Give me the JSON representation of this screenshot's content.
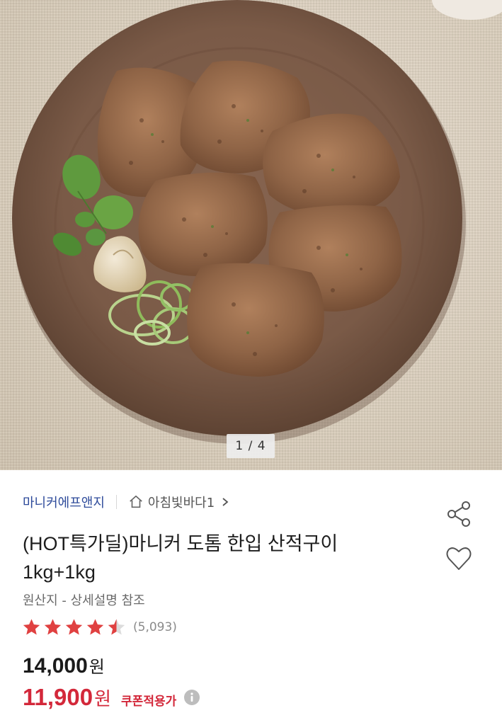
{
  "gallery": {
    "counter": "1 / 4"
  },
  "product": {
    "brand": "마니커에프앤지",
    "store": "아침빛바다1",
    "title_line1": "(HOT특가딜)마니커 도톰 한입 산적구이",
    "title_line2": "1kg+1kg",
    "origin": "원산지 - 상세설명 참조",
    "rating": 4.5,
    "review_count": "(5,093)",
    "original_price": "14,000",
    "sale_price": "11,900",
    "currency": "원",
    "coupon_label": "쿠폰적용가"
  },
  "colors": {
    "brand_link": "#2d4a9a",
    "sale_red": "#d3283a",
    "star_red": "#e04141"
  },
  "icons": [
    "home-icon",
    "chevron-right-icon",
    "share-icon",
    "heart-icon",
    "star-icon",
    "info-icon"
  ]
}
